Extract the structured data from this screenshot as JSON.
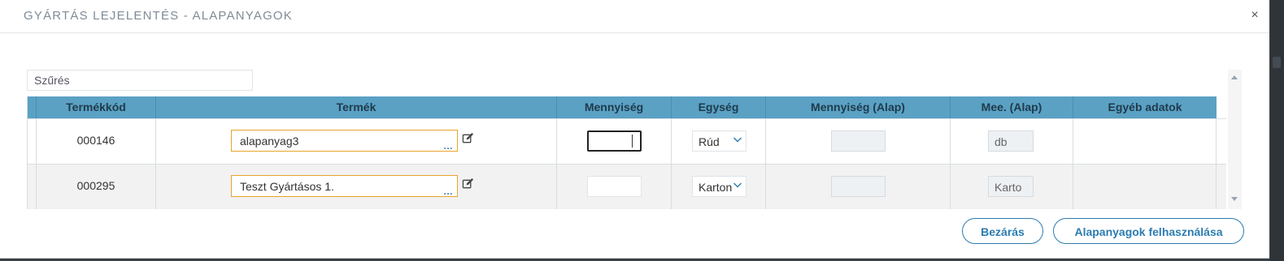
{
  "dialog": {
    "title": "GYÁRTÁS LEJELENTÉS - ALAPANYAGOK",
    "close_glyph": "×"
  },
  "filter": {
    "placeholder": "Szűrés"
  },
  "grid": {
    "columns": [
      "Termékkód",
      "Termék",
      "Mennyiség",
      "Egység",
      "Mennyiség (Alap)",
      "Mee. (Alap)",
      "Egyéb adatok"
    ],
    "rows": [
      {
        "code": "000146",
        "product": "alapanyag3",
        "quantity": "",
        "unit": "Rúd",
        "base_quantity": "",
        "base_unit": "db",
        "other": ""
      },
      {
        "code": "000295",
        "product": "Teszt Gyártásos 1.",
        "quantity": "",
        "unit": "Karton",
        "base_quantity": "",
        "base_unit": "Karto",
        "other": ""
      }
    ],
    "lookup_glyph": "...",
    "header_color": "#5aa1c4"
  },
  "buttons": {
    "close_label": "Bezárás",
    "use_label": "Alapanyagok felhasználása"
  },
  "colors": {
    "accent": "#2b7cb1",
    "product_border": "#e8a42c"
  }
}
